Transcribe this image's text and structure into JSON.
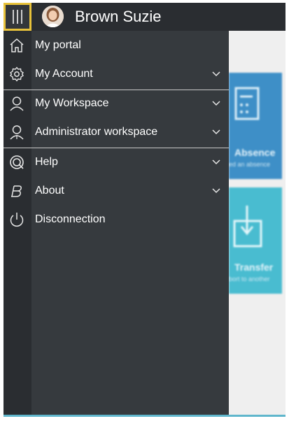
{
  "header": {
    "user_name": "Brown Suzie"
  },
  "menu": {
    "items": [
      {
        "label": "My portal",
        "icon": "home-icon",
        "expandable": false
      },
      {
        "label": "My Account",
        "icon": "gear-icon",
        "expandable": true
      },
      {
        "label": "My Workspace",
        "icon": "user-icon",
        "expandable": true
      },
      {
        "label": "Administrator workspace",
        "icon": "admin-user-icon",
        "expandable": true
      },
      {
        "label": "Help",
        "icon": "help-icon",
        "expandable": true
      },
      {
        "label": "About",
        "icon": "about-icon",
        "expandable": true
      },
      {
        "label": "Disconnection",
        "icon": "power-icon",
        "expandable": false
      }
    ]
  },
  "background": {
    "tiles": [
      {
        "label": "Absence",
        "sub": "ed an absence",
        "color": "#3e8fc7"
      },
      {
        "label": "Transfer",
        "sub": "bort to another",
        "color": "#49bcd0"
      }
    ]
  },
  "colors": {
    "topbar": "#2a2d31",
    "drawer": "#363a3e",
    "accent": "#e8c23a"
  }
}
